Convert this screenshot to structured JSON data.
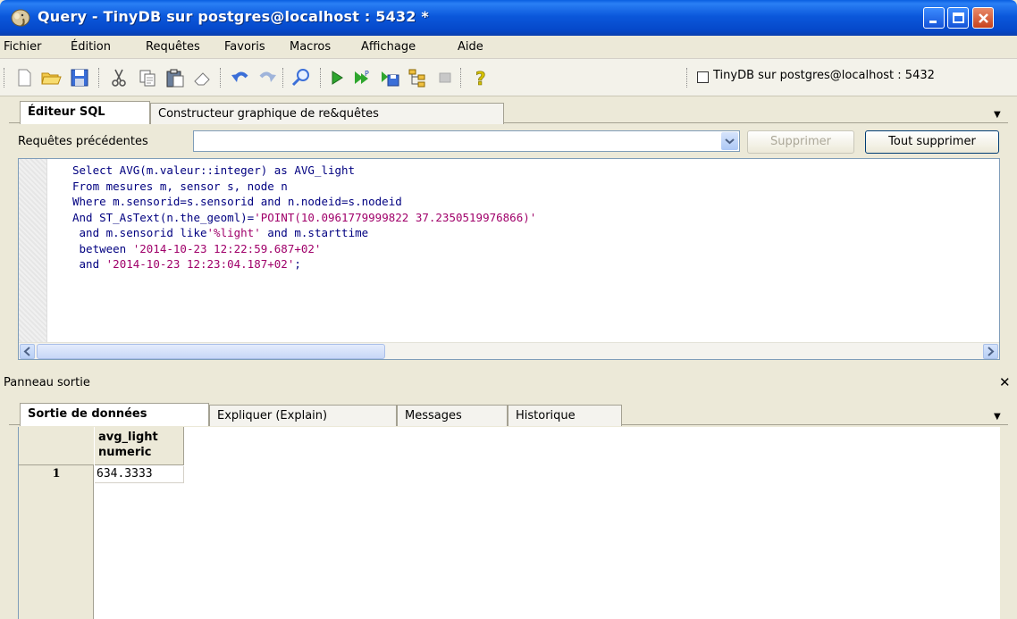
{
  "window": {
    "title": "Query - TinyDB sur postgres@localhost : 5432 *"
  },
  "menu": [
    "Fichier",
    "Édition",
    "Requêtes",
    "Favoris",
    "Macros",
    "Affichage",
    "Aide"
  ],
  "toolbar": {
    "connection_label": "TinyDB sur postgres@localhost : 5432"
  },
  "editor_tabs": [
    "Éditeur SQL",
    "Constructeur graphique de re&quêtes"
  ],
  "previous_queries": {
    "label": "Requêtes précédentes",
    "value": "",
    "delete_label": "Supprimer",
    "delete_all_label": "Tout supprimer"
  },
  "sql": {
    "lines": [
      "Select AVG(m.valeur::integer) as AVG_light",
      "From mesures m, sensor s, node n",
      "Where m.sensorid=s.sensorid and n.nodeid=s.nodeid",
      "And ST_AsText(n.the_geoml)=",
      "'POINT(10.0961779999822 37.2350519976866)'",
      " and m.sensorid like",
      "'%light'",
      " and m.starttime",
      " between ",
      "'2014-10-23 12:22:59.687+02'",
      " and ",
      "'2014-10-23 12:23:04.187+02'",
      ";"
    ]
  },
  "output_panel": {
    "label": "Panneau sortie",
    "tabs": [
      "Sortie de données",
      "Expliquer (Explain)",
      "Messages",
      "Historique"
    ],
    "columns": [
      {
        "name": "avg_light",
        "type": "numeric"
      }
    ],
    "rows": [
      {
        "num": "1",
        "values": [
          "634.3333"
        ]
      }
    ]
  },
  "colors": {
    "titlebar": "#0b58db",
    "keyword": "#000080",
    "string": "#a0006a"
  }
}
